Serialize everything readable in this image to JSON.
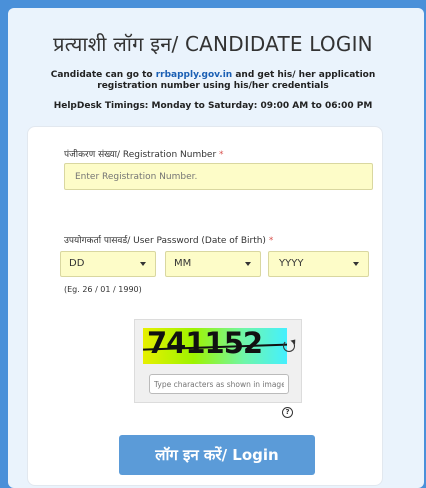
{
  "header": {
    "title": "प्रत्याशी लॉग इन/ CANDIDATE LOGIN",
    "subtitle_prefix": "Candidate can go to ",
    "subtitle_link": "rrbapply.gov.in",
    "subtitle_suffix": " and get his/ her application registration number using his/her credentials",
    "helpdesk": "HelpDesk Timings: Monday to Saturday: 09:00 AM to 06:00 PM"
  },
  "form": {
    "registration_label": "पंजीकरण संख्या/ Registration Number",
    "required_mark": "*",
    "registration_placeholder": "Enter Registration Number.",
    "password_label": "उपयोगकर्ता पासवर्ड/ User Password (Date of Birth)",
    "day_value": "DD",
    "month_value": "MM",
    "year_value": "YYYY",
    "example": "(Eg. 26 / 01 / 1990)",
    "captcha_text": "741152",
    "captcha_placeholder": "Type characters as shown in image",
    "help_symbol": "?",
    "login_label": "लॉग इन करें/ Login"
  },
  "colors": {
    "background": "#4a90d9",
    "card": "#eaf3fc",
    "input_fill": "#fdfcc8",
    "button": "#5b9bd8",
    "link": "#1a5fb4",
    "required": "#d9534f"
  }
}
